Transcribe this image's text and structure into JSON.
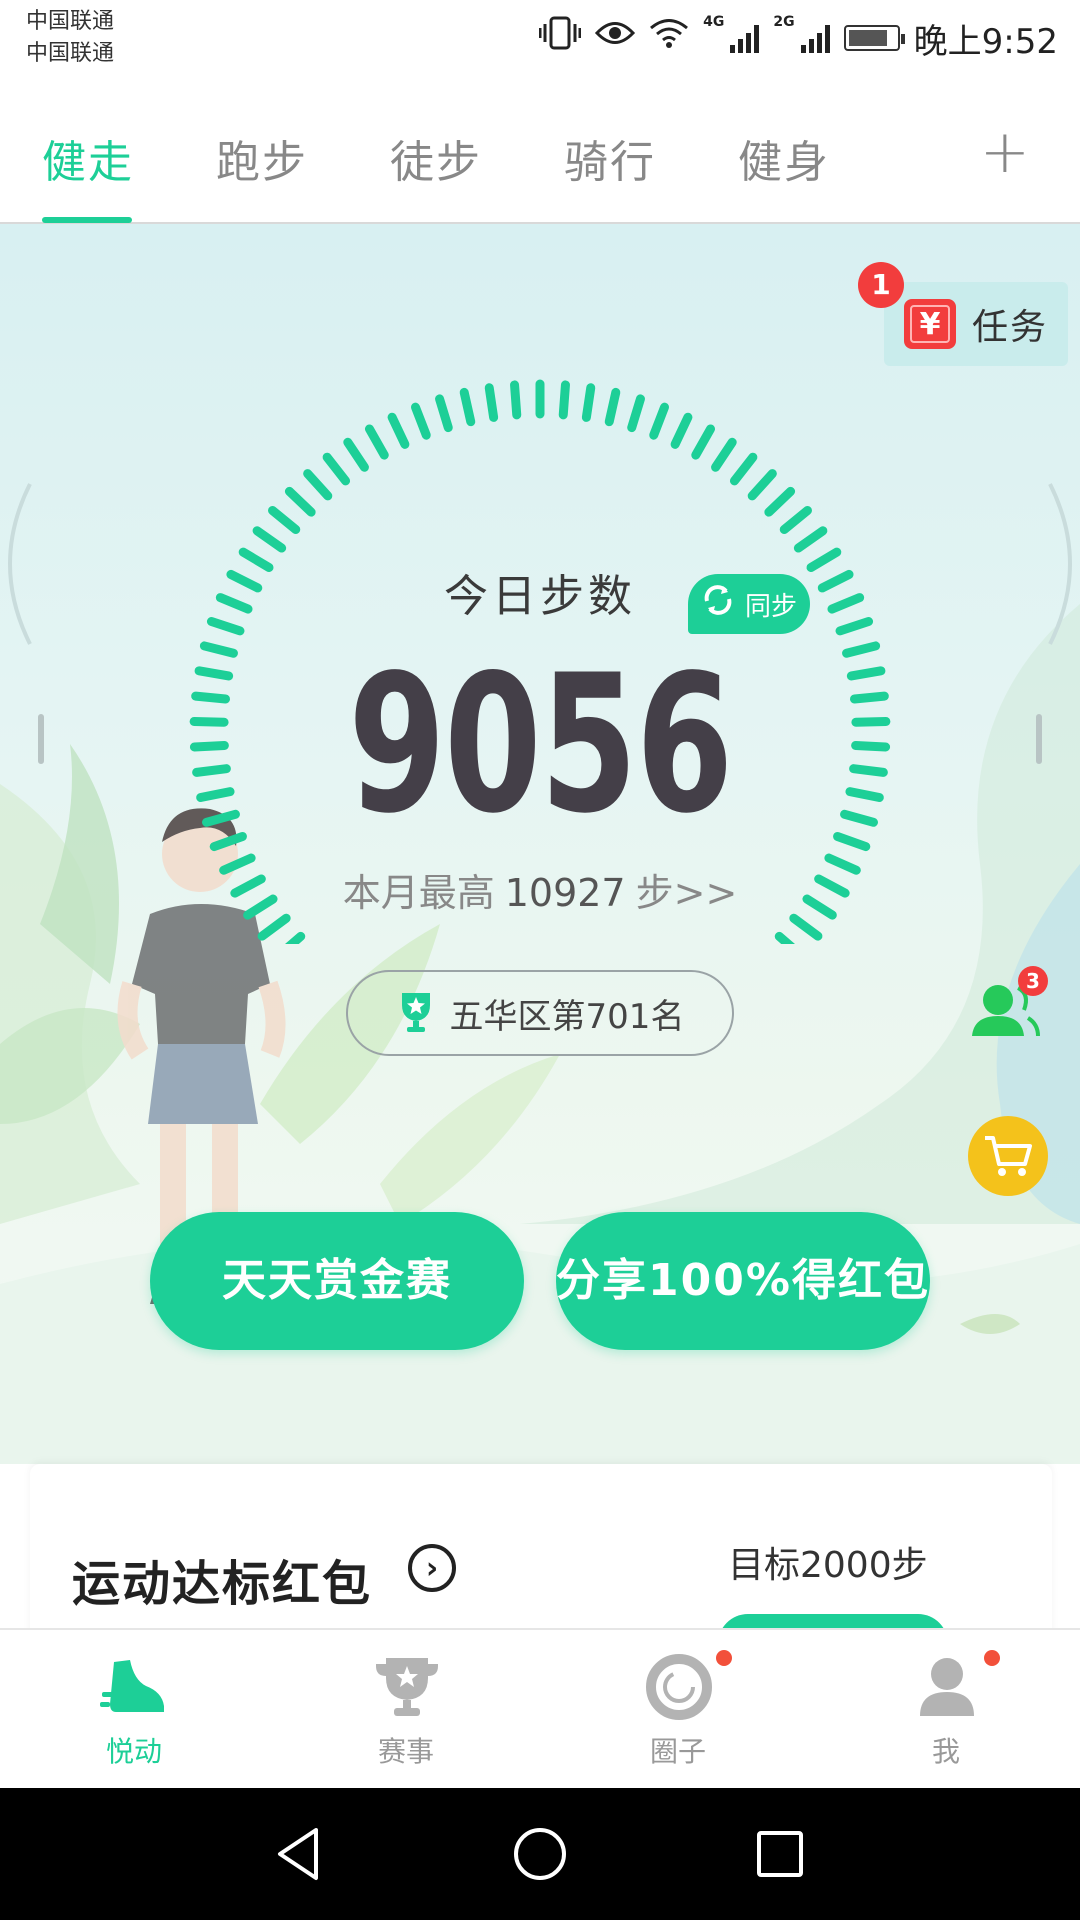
{
  "status_bar": {
    "carrier1": "中国联通",
    "carrier2": "中国联通",
    "net1": "4G",
    "net2": "2G",
    "time": "晚上9:52"
  },
  "tabs": [
    {
      "label": "健走",
      "active": true
    },
    {
      "label": "跑步",
      "active": false
    },
    {
      "label": "徒步",
      "active": false
    },
    {
      "label": "骑行",
      "active": false
    },
    {
      "label": "健身",
      "active": false
    }
  ],
  "tab_add": "+",
  "task": {
    "label": "任务",
    "badge": "1",
    "icon_char": "¥"
  },
  "gauge": {
    "today_label": "今日步数",
    "sync_label": "同步",
    "steps": "9056",
    "month_best_prefix": "本月最高",
    "month_best_value": "10927",
    "month_best_suffix": "步>>",
    "rank_text": "五华区第701名"
  },
  "friends_badge": "3",
  "actions": {
    "button1": "天天赏金赛",
    "button2": "分享100%得红包"
  },
  "card": {
    "title": "运动达标红包",
    "arrow": "›",
    "target": "目标2000步"
  },
  "bottom_nav": [
    {
      "label": "悦动",
      "active": true
    },
    {
      "label": "赛事",
      "active": false
    },
    {
      "label": "圈子",
      "active": false
    },
    {
      "label": "我",
      "active": false
    }
  ],
  "colors": {
    "accent": "#1dcf97",
    "badge_red": "#f23d3d",
    "cart_yellow": "#f4c21b",
    "steps_text": "#443f48"
  }
}
